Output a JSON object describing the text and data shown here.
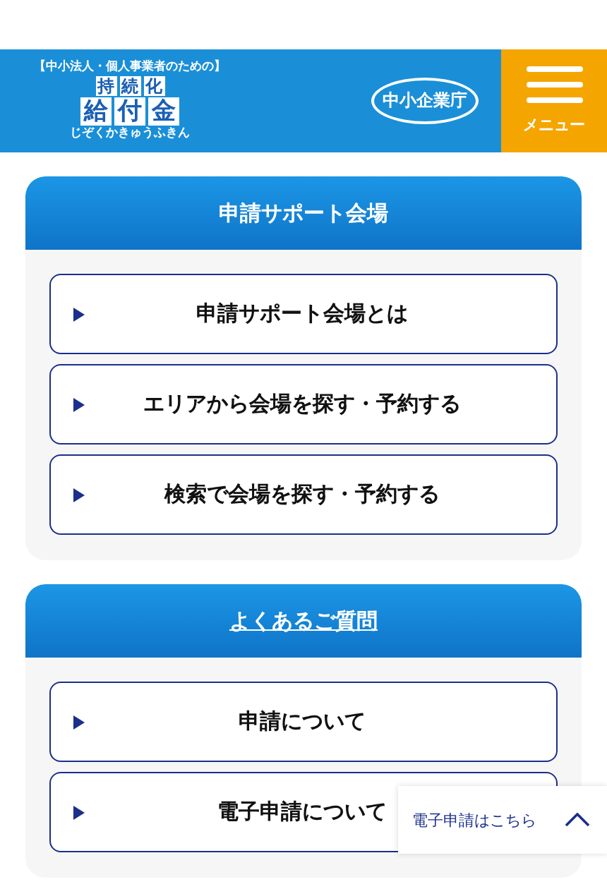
{
  "header": {
    "logo": {
      "caption": "【中小法人・個人事業者のための】",
      "line1": [
        "持",
        "続",
        "化"
      ],
      "line2": [
        "給",
        "付",
        "金"
      ],
      "reading": "じぞくかきゅうふきん"
    },
    "agency": "中小企業庁",
    "menu": "メニュー"
  },
  "sections": [
    {
      "title": "申請サポート会場",
      "link": false,
      "items": [
        "申請サポート会場とは",
        "エリアから会場を探す・予約する",
        "検索で会場を探す・予約する"
      ]
    },
    {
      "title": "よくあるご質問",
      "link": true,
      "items": [
        "申請について",
        "電子申請について"
      ]
    }
  ],
  "floating": {
    "label": "電子申請はこちら"
  }
}
